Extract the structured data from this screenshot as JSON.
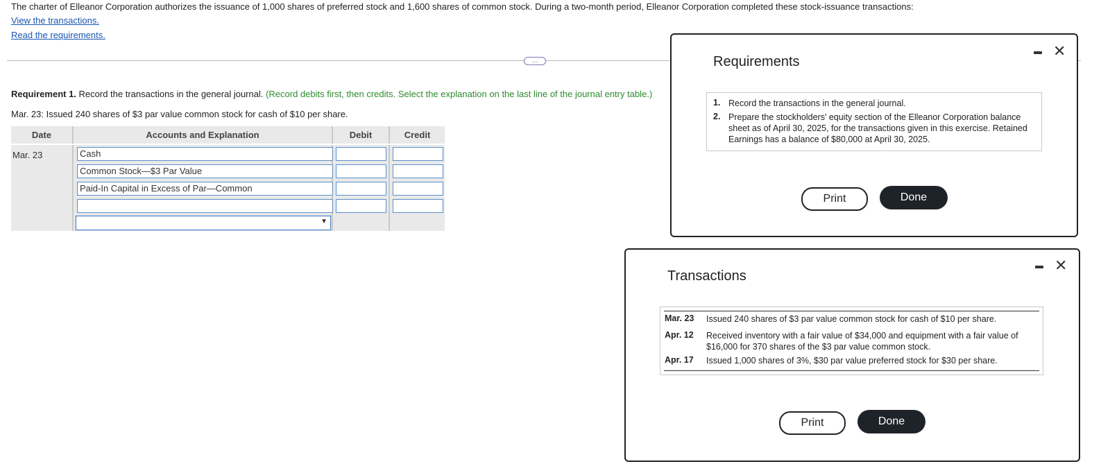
{
  "intro": "The charter of Elleanor Corporation authorizes the issuance of 1,000 shares of preferred stock and 1,600 shares of common stock. During a two-month period, Elleanor Corporation completed these stock-issuance transactions:",
  "links": {
    "view_transactions": "View the transactions.",
    "read_requirements": "Read the requirements."
  },
  "more_button": "…",
  "requirement1": {
    "label": "Requirement 1.",
    "text": " Record the transactions in the general journal. ",
    "hint": "(Record debits first, then credits. Select the explanation on the last line of the journal entry table.)"
  },
  "entry_description": "Mar. 23: Issued 240 shares of $3 par value common stock for cash of $10 per share.",
  "journal": {
    "headers": {
      "date": "Date",
      "accounts": "Accounts and Explanation",
      "debit": "Debit",
      "credit": "Credit"
    },
    "date": "Mar. 23",
    "rows": [
      {
        "account": "Cash",
        "debit": "",
        "credit": ""
      },
      {
        "account": "Common Stock—$3 Par Value",
        "debit": "",
        "credit": ""
      },
      {
        "account": "Paid-In Capital in Excess of Par—Common",
        "debit": "",
        "credit": ""
      },
      {
        "account": "",
        "debit": "",
        "credit": ""
      }
    ],
    "explanation_select": ""
  },
  "requirements_modal": {
    "title": "Requirements",
    "items": [
      {
        "num": "1.",
        "text": "Record the transactions in the general journal."
      },
      {
        "num": "2.",
        "text": "Prepare the stockholders' equity section of the Elleanor Corporation balance sheet as of April 30, 2025, for the transactions given in this exercise. Retained Earnings has a balance of $80,000 at April 30, 2025."
      }
    ],
    "print_label": "Print",
    "done_label": "Done"
  },
  "transactions_modal": {
    "title": "Transactions",
    "items": [
      {
        "date": "Mar. 23",
        "text": "Issued 240 shares of $3 par value common stock for cash of $10 per share."
      },
      {
        "date": "Apr. 12",
        "text": "Received inventory with a fair value of $34,000 and equipment with a fair value of $16,000 for 370 shares of the $3 par value common stock."
      },
      {
        "date": "Apr. 17",
        "text": "Issued 1,000 shares of 3%, $30 par value preferred stock for $30 per share."
      }
    ],
    "print_label": "Print",
    "done_label": "Done"
  },
  "icons": {
    "minimize": "minimize-icon",
    "close": "close-icon"
  },
  "colors": {
    "link": "#1a56b0",
    "hint": "#2e8b2e",
    "done_button": "#1e2329",
    "input_border": "#5b8fc9"
  }
}
